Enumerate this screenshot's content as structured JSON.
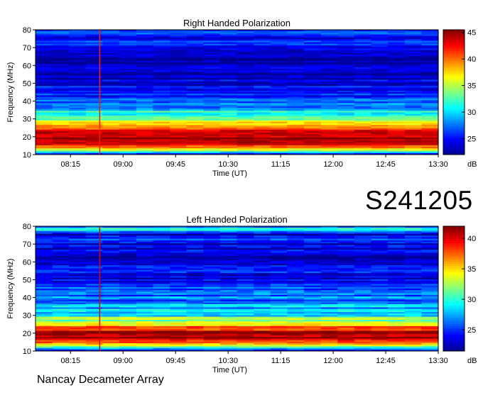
{
  "station_code": "S241205",
  "footer": "Nancay Decameter Array",
  "chart_data": [
    {
      "type": "heatmap",
      "title": "Right Handed Polarization",
      "xlabel": "Time (UT)",
      "ylabel": "Frequency (MHz)",
      "x_ticks": [
        "08:15",
        "09:00",
        "09:45",
        "10:30",
        "11:15",
        "12:00",
        "12:45",
        "13:30"
      ],
      "y_ticks": [
        10,
        20,
        30,
        40,
        50,
        60,
        70,
        80
      ],
      "ylim": [
        10,
        80
      ],
      "colorbar": {
        "label": "dB",
        "ticks": [
          25,
          30,
          35,
          40,
          45
        ],
        "range": [
          22,
          45.5
        ]
      },
      "colormap": [
        "#00008f",
        "#0000ff",
        "#0080ff",
        "#00ffff",
        "#80ff80",
        "#ffff00",
        "#ff8000",
        "#ff0000",
        "#800000"
      ],
      "profile_db": [
        {
          "f": 10,
          "db": 24
        },
        {
          "f": 12,
          "db": 34
        },
        {
          "f": 14,
          "db": 39
        },
        {
          "f": 16,
          "db": 43
        },
        {
          "f": 18,
          "db": 45
        },
        {
          "f": 20,
          "db": 44
        },
        {
          "f": 22,
          "db": 44
        },
        {
          "f": 24,
          "db": 42
        },
        {
          "f": 26,
          "db": 40
        },
        {
          "f": 28,
          "db": 37
        },
        {
          "f": 30,
          "db": 33
        },
        {
          "f": 32,
          "db": 31
        },
        {
          "f": 34,
          "db": 31
        },
        {
          "f": 36,
          "db": 29
        },
        {
          "f": 38,
          "db": 27
        },
        {
          "f": 40,
          "db": 28.5
        },
        {
          "f": 42,
          "db": 26.5
        },
        {
          "f": 45,
          "db": 25
        },
        {
          "f": 50,
          "db": 24
        },
        {
          "f": 60,
          "db": 23
        },
        {
          "f": 70,
          "db": 23
        },
        {
          "f": 73,
          "db": 26
        },
        {
          "f": 75,
          "db": 23
        },
        {
          "f": 79,
          "db": 28
        },
        {
          "f": 80,
          "db": 23
        }
      ],
      "spikes": [
        {
          "time": "08:40",
          "db": 42
        }
      ],
      "time_range": [
        "07:45",
        "13:30"
      ]
    },
    {
      "type": "heatmap",
      "title": "Left Handed Polarization",
      "xlabel": "Time (UT)",
      "ylabel": "Frequency (MHz)",
      "x_ticks": [
        "08:15",
        "09:00",
        "09:45",
        "10:30",
        "11:15",
        "12:00",
        "12:45",
        "13:30"
      ],
      "y_ticks": [
        10,
        20,
        30,
        40,
        50,
        60,
        70,
        80
      ],
      "ylim": [
        10,
        80
      ],
      "colorbar": {
        "label": "dB",
        "ticks": [
          25,
          30,
          35,
          40
        ],
        "range": [
          21.5,
          42
        ]
      },
      "colormap": [
        "#00008f",
        "#0000ff",
        "#0080ff",
        "#00ffff",
        "#80ff80",
        "#ffff00",
        "#ff8000",
        "#ff0000",
        "#800000"
      ],
      "profile_db": [
        {
          "f": 10,
          "db": 24
        },
        {
          "f": 12,
          "db": 30
        },
        {
          "f": 14,
          "db": 36
        },
        {
          "f": 16,
          "db": 40
        },
        {
          "f": 18,
          "db": 41
        },
        {
          "f": 20,
          "db": 41
        },
        {
          "f": 22,
          "db": 39
        },
        {
          "f": 24,
          "db": 36
        },
        {
          "f": 26,
          "db": 33
        },
        {
          "f": 28,
          "db": 32
        },
        {
          "f": 30,
          "db": 29
        },
        {
          "f": 32,
          "db": 28
        },
        {
          "f": 34,
          "db": 28
        },
        {
          "f": 36,
          "db": 27
        },
        {
          "f": 38,
          "db": 26
        },
        {
          "f": 40,
          "db": 26.5
        },
        {
          "f": 42,
          "db": 25.5
        },
        {
          "f": 45,
          "db": 25
        },
        {
          "f": 50,
          "db": 24
        },
        {
          "f": 60,
          "db": 23
        },
        {
          "f": 70,
          "db": 23
        },
        {
          "f": 73,
          "db": 25
        },
        {
          "f": 75,
          "db": 23
        },
        {
          "f": 79,
          "db": 30
        },
        {
          "f": 80,
          "db": 23
        }
      ],
      "spikes": [
        {
          "time": "08:40",
          "db": 40
        }
      ],
      "time_range": [
        "07:45",
        "13:30"
      ]
    }
  ]
}
